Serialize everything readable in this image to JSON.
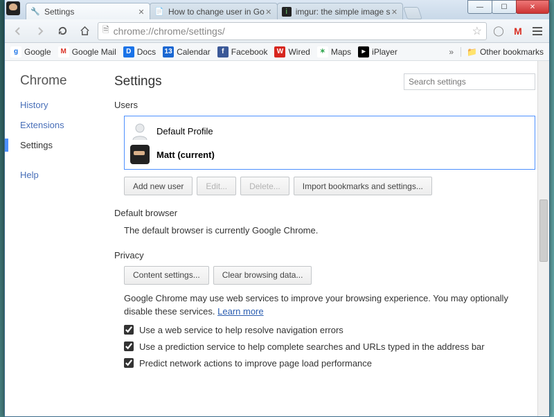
{
  "tabs": [
    {
      "label": "Settings",
      "icon": "wrench"
    },
    {
      "label": "How to change user in Go",
      "icon": "doc"
    },
    {
      "label": "imgur: the simple image s",
      "icon": "imgur"
    }
  ],
  "omnibox": {
    "url": "chrome://chrome/settings/"
  },
  "bookmarks_bar": {
    "items": [
      {
        "label": "Google",
        "icon_letter": "g",
        "bg": "#fff",
        "fg": "#1a73e8"
      },
      {
        "label": "Google Mail",
        "icon_letter": "M",
        "bg": "#fff",
        "fg": "#d93025"
      },
      {
        "label": "Docs",
        "icon_letter": "D",
        "bg": "#1a73e8",
        "fg": "#fff"
      },
      {
        "label": "Calendar",
        "icon_letter": "13",
        "bg": "#1a67d2",
        "fg": "#fff"
      },
      {
        "label": "Facebook",
        "icon_letter": "f",
        "bg": "#3b5998",
        "fg": "#fff"
      },
      {
        "label": "Wired",
        "icon_letter": "W",
        "bg": "#d7261e",
        "fg": "#fff"
      },
      {
        "label": "Maps",
        "icon_letter": "✶",
        "bg": "#fff",
        "fg": "#34a853"
      },
      {
        "label": "iPlayer",
        "icon_letter": "▸",
        "bg": "#000",
        "fg": "#fff"
      }
    ],
    "other": "Other bookmarks"
  },
  "sidebar": {
    "brand": "Chrome",
    "items": [
      "History",
      "Extensions",
      "Settings",
      "Help"
    ],
    "active_index": 2
  },
  "settings": {
    "title": "Settings",
    "search_placeholder": "Search settings",
    "users": {
      "title": "Users",
      "profiles": [
        {
          "name": "Default Profile",
          "current": false,
          "avatar": "silhouette"
        },
        {
          "name": "Matt (current)",
          "current": true,
          "avatar": "ninja"
        }
      ],
      "buttons": {
        "add": "Add new user",
        "edit": "Edit...",
        "delete": "Delete...",
        "import": "Import bookmarks and settings..."
      }
    },
    "default_browser": {
      "title": "Default browser",
      "text": "The default browser is currently Google Chrome."
    },
    "privacy": {
      "title": "Privacy",
      "content_btn": "Content settings...",
      "clear_btn": "Clear browsing data...",
      "desc": "Google Chrome may use web services to improve your browsing experience. You may optionally disable these services. ",
      "learn_more": "Learn more",
      "checks": [
        "Use a web service to help resolve navigation errors",
        "Use a prediction service to help complete searches and URLs typed in the address bar",
        "Predict network actions to improve page load performance"
      ]
    }
  }
}
